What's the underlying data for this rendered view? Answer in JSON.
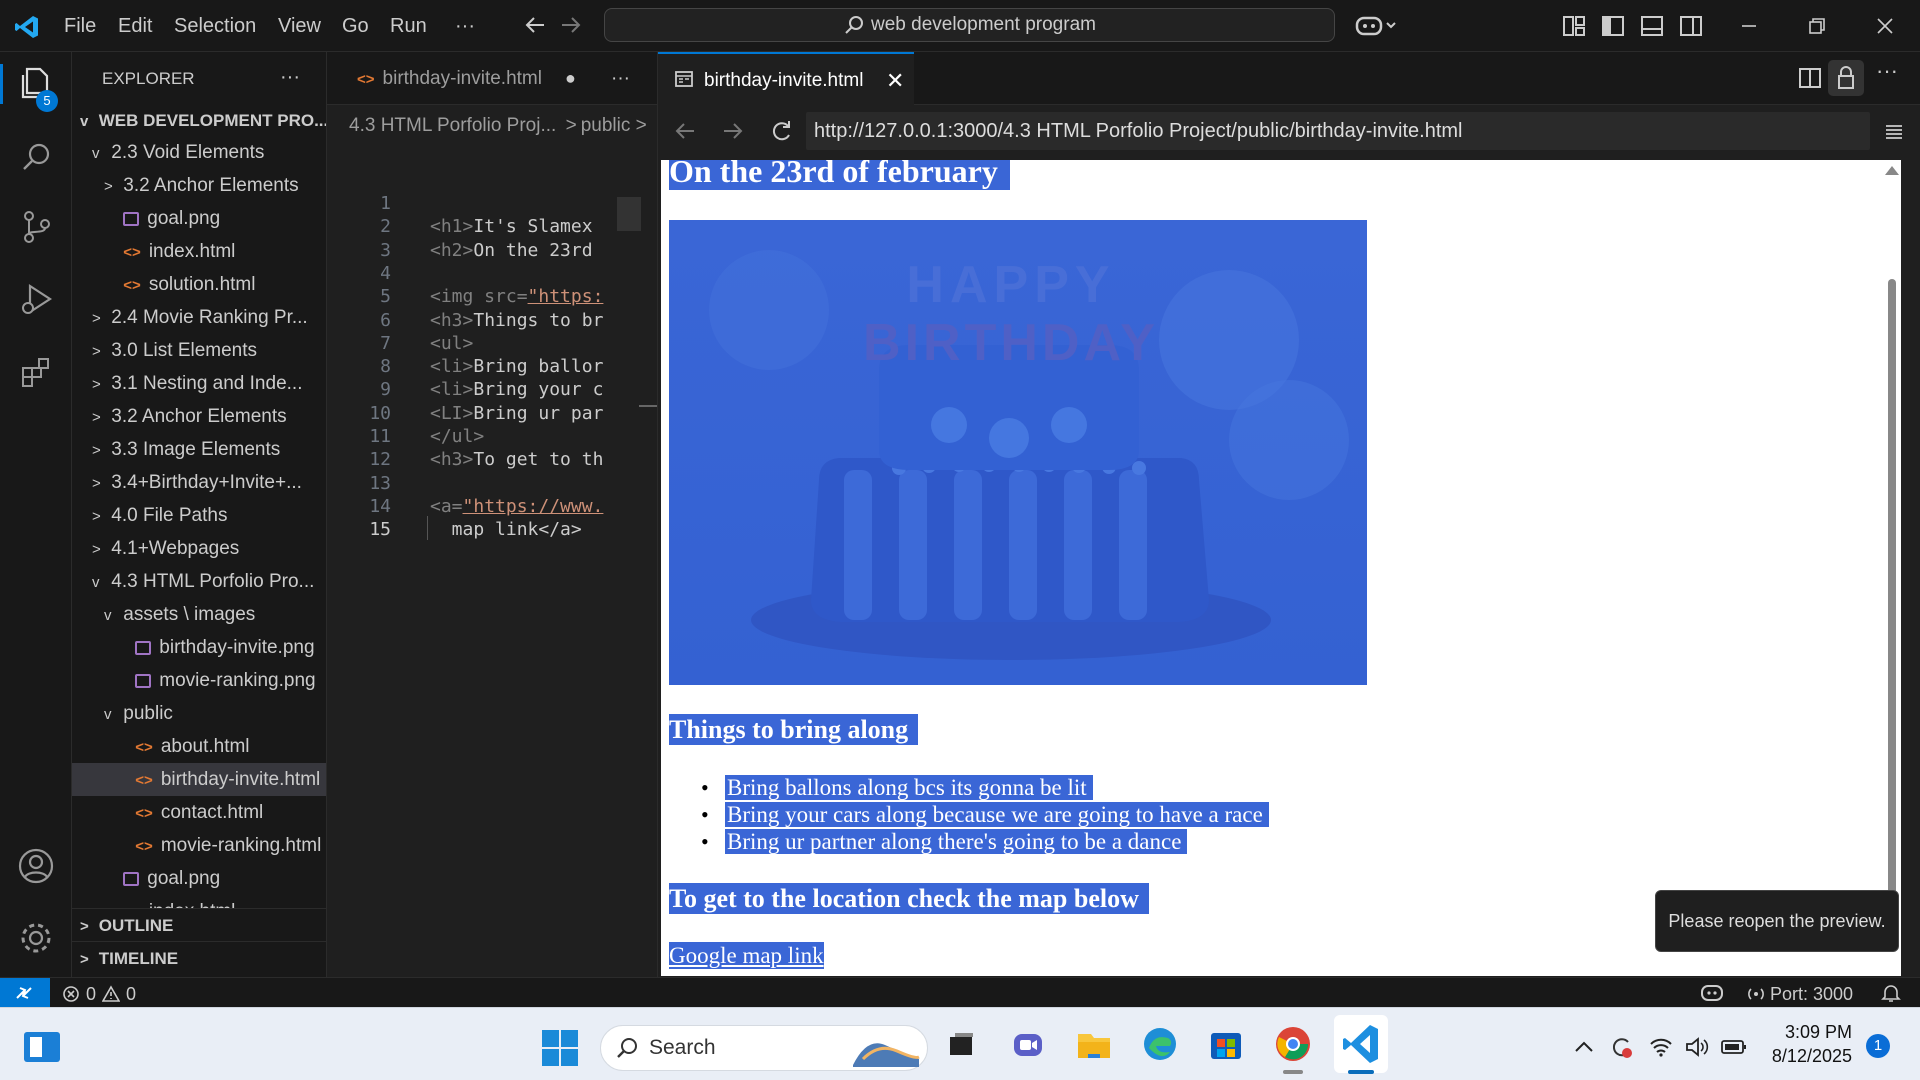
{
  "menu": [
    "File",
    "Edit",
    "Selection",
    "View",
    "Go",
    "Run",
    "···"
  ],
  "command_center": {
    "text": "web development program"
  },
  "activity_badge": "5",
  "explorer": {
    "title": "EXPLORER",
    "more": "···",
    "root": "WEB DEVELOPMENT PRO...",
    "items": [
      {
        "label": "2.3 Void Elements",
        "chev": "v",
        "indent": 1,
        "type": "folder"
      },
      {
        "label": "3.2 Anchor Elements",
        "chev": ">",
        "indent": 2,
        "type": "folder"
      },
      {
        "label": "goal.png",
        "chev": "",
        "indent": 2,
        "type": "img"
      },
      {
        "label": "index.html",
        "chev": "",
        "indent": 2,
        "type": "html"
      },
      {
        "label": "solution.html",
        "chev": "",
        "indent": 2,
        "type": "html"
      },
      {
        "label": "2.4 Movie Ranking Pr...",
        "chev": ">",
        "indent": 1,
        "type": "folder"
      },
      {
        "label": "3.0 List Elements",
        "chev": ">",
        "indent": 1,
        "type": "folder"
      },
      {
        "label": "3.1 Nesting and Inde...",
        "chev": ">",
        "indent": 1,
        "type": "folder"
      },
      {
        "label": "3.2 Anchor Elements",
        "chev": ">",
        "indent": 1,
        "type": "folder"
      },
      {
        "label": "3.3 Image Elements",
        "chev": ">",
        "indent": 1,
        "type": "folder"
      },
      {
        "label": "3.4+Birthday+Invite+...",
        "chev": ">",
        "indent": 1,
        "type": "folder"
      },
      {
        "label": "4.0 File Paths",
        "chev": ">",
        "indent": 1,
        "type": "folder"
      },
      {
        "label": "4.1+Webpages",
        "chev": ">",
        "indent": 1,
        "type": "folder"
      },
      {
        "label": "4.3 HTML Porfolio Pro...",
        "chev": "v",
        "indent": 1,
        "type": "folder"
      },
      {
        "label": "assets \\ images",
        "chev": "v",
        "indent": 2,
        "type": "folder"
      },
      {
        "label": "birthday-invite.png",
        "chev": "",
        "indent": 3,
        "type": "img"
      },
      {
        "label": "movie-ranking.png",
        "chev": "",
        "indent": 3,
        "type": "img"
      },
      {
        "label": "public",
        "chev": "v",
        "indent": 2,
        "type": "folder"
      },
      {
        "label": "about.html",
        "chev": "",
        "indent": 3,
        "type": "html"
      },
      {
        "label": "birthday-invite.html",
        "chev": "",
        "indent": 3,
        "type": "html",
        "selected": true
      },
      {
        "label": "contact.html",
        "chev": "",
        "indent": 3,
        "type": "html"
      },
      {
        "label": "movie-ranking.html",
        "chev": "",
        "indent": 3,
        "type": "html"
      },
      {
        "label": "goal.png",
        "chev": "",
        "indent": 2,
        "type": "img"
      },
      {
        "label": "index.html",
        "chev": "",
        "indent": 2,
        "type": "html"
      }
    ],
    "outline": "OUTLINE",
    "timeline": "TIMELINE"
  },
  "editor": {
    "tab": "birthday-invite.html",
    "breadcrumb_folder": "4.3 HTML Porfolio Proj...",
    "breadcrumb_sub": "public",
    "more": "···",
    "lines": [
      {
        "n": "1",
        "tag": "",
        "text": ""
      },
      {
        "n": "2",
        "tag": "<h1>",
        "text": "It's Slamex"
      },
      {
        "n": "3",
        "tag": "<h2>",
        "text": "On the 23rd"
      },
      {
        "n": "4",
        "tag": "",
        "text": ""
      },
      {
        "n": "5",
        "tag": "<img src=",
        "text": "\"https:"
      },
      {
        "n": "6",
        "tag": "<h3>",
        "text": "Things to br"
      },
      {
        "n": "7",
        "tag": "<ul>",
        "text": ""
      },
      {
        "n": "8",
        "tag": "<li>",
        "text": "Bring ballor"
      },
      {
        "n": "9",
        "tag": "<li>",
        "text": "Bring your c"
      },
      {
        "n": "10",
        "tag": "<LI>",
        "text": "Bring ur par"
      },
      {
        "n": "11",
        "tag": "</ul>",
        "text": ""
      },
      {
        "n": "12",
        "tag": "<h3>",
        "text": "To get to th"
      },
      {
        "n": "13",
        "tag": "",
        "text": ""
      },
      {
        "n": "14",
        "tag": "<a=",
        "text": "\"https://www."
      },
      {
        "n": "15",
        "tag": "",
        "text": "  map link</a>"
      }
    ]
  },
  "preview": {
    "tab": "birthday-invite.html",
    "url": "http://127.0.0.1:3000/4.3 HTML Porfolio Project/public/birthday-invite.html",
    "h2": "On the 23rd of february",
    "image_text": "HAPPY BIRTHDAY",
    "h3_things": "Things to bring along",
    "list": [
      "Bring ballons along bcs its gonna be lit",
      "Bring your cars along because we are going to have a race",
      "Bring ur partner along there's going to be a dance"
    ],
    "h3_location": "To get to the location check the map below",
    "link": "Google map link",
    "toast": "Please reopen the preview."
  },
  "status": {
    "errors": "0",
    "warnings": "0",
    "port": "Port: 3000"
  },
  "taskbar": {
    "search": "Search",
    "time": "3:09 PM",
    "date": "8/12/2025",
    "notif": "1"
  },
  "colors": {
    "accent": "#0078d4",
    "highlight": "#3a66d6",
    "vscode_blue": "#23a9f2"
  }
}
